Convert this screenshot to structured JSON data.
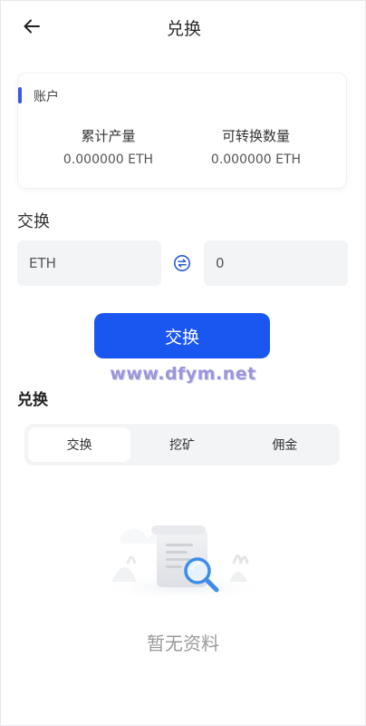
{
  "header": {
    "title": "兑换",
    "back_icon": "arrow-left-icon"
  },
  "account": {
    "label": "账户",
    "accent_color": "#3a57e8",
    "stats": [
      {
        "label": "累计产量",
        "value": "0.000000 ETH"
      },
      {
        "label": "可转换数量",
        "value": "0.000000 ETH"
      }
    ]
  },
  "exchange": {
    "section_title": "交换",
    "from_value": "ETH",
    "to_value": "0",
    "swap_icon": "swap-icon",
    "button_label": "交换",
    "button_color": "#1a56f0"
  },
  "watermark": "www.dfym.net",
  "history": {
    "title": "兑换",
    "tabs": [
      {
        "label": "交换",
        "active": true
      },
      {
        "label": "挖矿",
        "active": false
      },
      {
        "label": "佣金",
        "active": false
      }
    ],
    "empty_text": "暂无资料",
    "empty_icon": "document-search-icon"
  }
}
